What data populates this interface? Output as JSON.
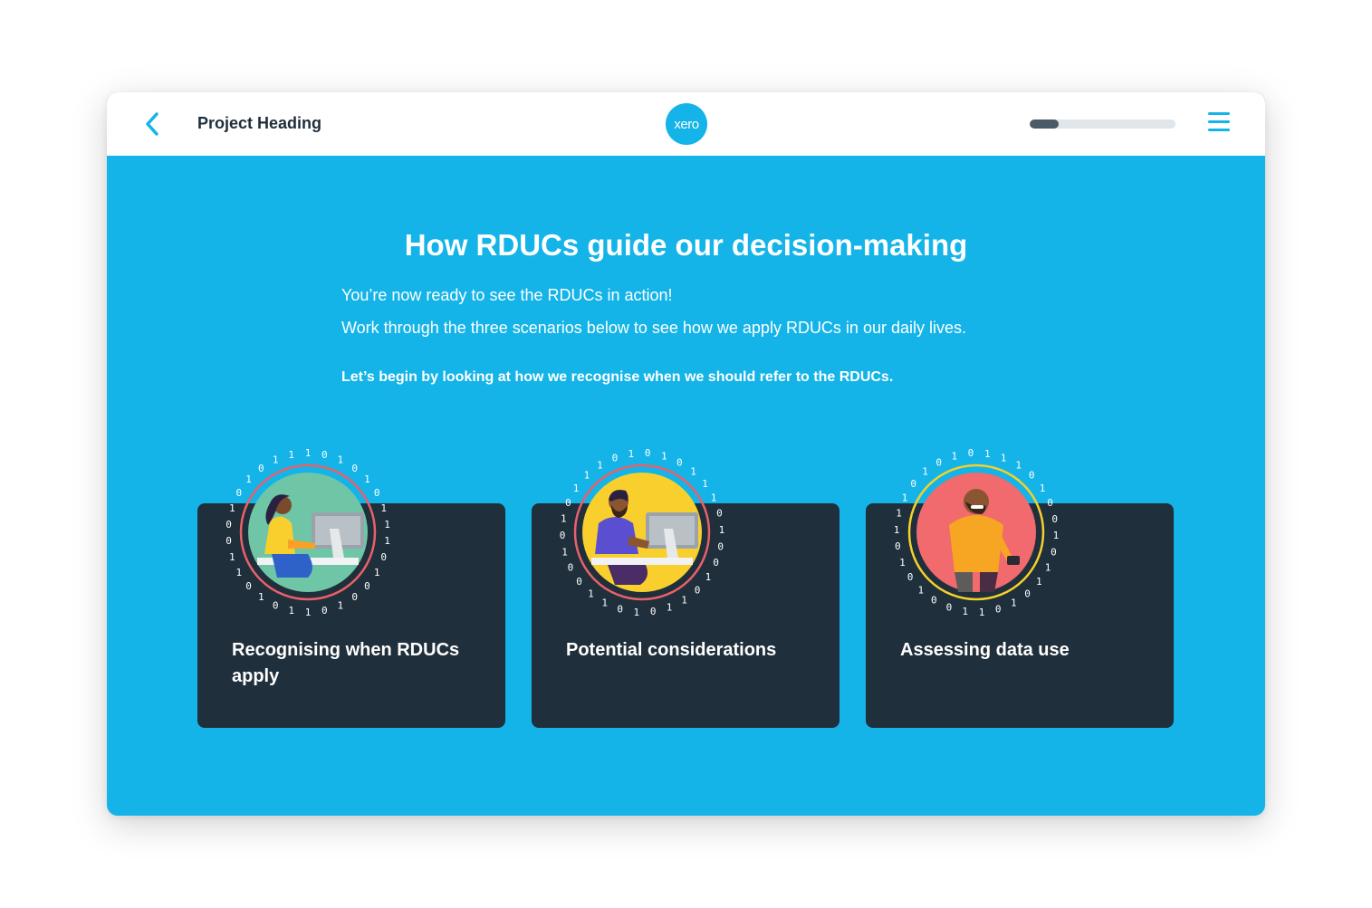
{
  "header": {
    "back_label": "Back",
    "project_heading": "Project Heading",
    "logo_text": "xero",
    "progress": 0.2,
    "menu_label": "Menu"
  },
  "main": {
    "title": "How RDUCs guide our decision-making",
    "intro_line1": "You’re now ready to see the RDUCs in action!",
    "intro_line2": "Work through the three scenarios below to see how we apply RDUCs in our daily lives.",
    "intro_bold": "Let’s begin by looking at how we recognise when we should refer to the RDUCs."
  },
  "cards": [
    {
      "label": "Recognising when RDUCs apply",
      "icon": "person-at-desk-icon",
      "accent": "#e9606a",
      "fill": "#6ec6a6"
    },
    {
      "label": "Potential considerations",
      "icon": "bearded-person-at-desk-icon",
      "accent": "#e9606a",
      "fill": "#f9cf2e"
    },
    {
      "label": "Assessing data use",
      "icon": "person-on-phone-icon",
      "accent": "#f5d02b",
      "fill": "#f06a6e"
    }
  ],
  "colors": {
    "brand": "#14b4e8",
    "card": "#1f2f3b",
    "text_dark": "#1f2d3a"
  }
}
